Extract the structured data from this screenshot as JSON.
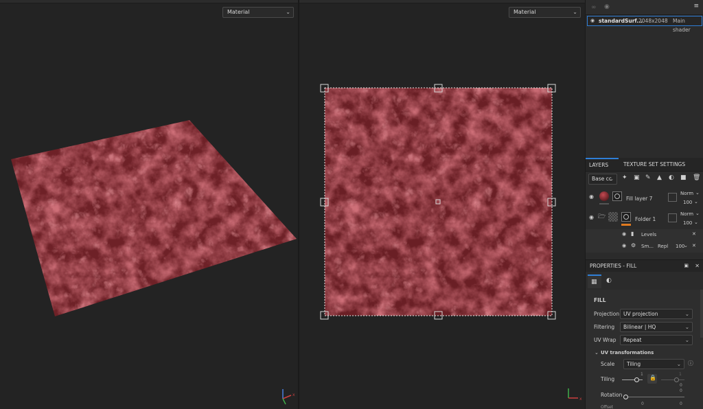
{
  "viewport3d": {
    "dropdown": "Material",
    "axis_x": "x"
  },
  "viewport2d": {
    "dropdown": "Material",
    "axis_x": "x"
  },
  "texture_set": {
    "name": "standardSurf...",
    "resolution": "2048x2048",
    "shader": "Main shader"
  },
  "layers_panel": {
    "tab_layers": "LAYERS",
    "tab_texture_settings": "TEXTURE SET SETTINGS",
    "channel": "Base cc",
    "layers": [
      {
        "name": "Fill layer 7",
        "blend": "Norm",
        "opacity": "100"
      },
      {
        "name": "Folder 1",
        "blend": "Norm",
        "opacity": "100"
      }
    ],
    "effects": [
      {
        "name": "Levels"
      },
      {
        "name": "Sm...",
        "blend": "Repl",
        "opacity": "100"
      }
    ]
  },
  "properties": {
    "header": "PROPERTIES - FILL",
    "section": "FILL",
    "projection_label": "Projection",
    "projection_value": "UV projection",
    "filtering_label": "Filtering",
    "filtering_value": "Bilinear | HQ",
    "uvwrap_label": "UV Wrap",
    "uvwrap_value": "Repeat",
    "uv_transform_label": "UV transformations",
    "scale_label": "Scale",
    "scale_value": "Tiling",
    "tiling_label": "Tiling",
    "tiling_value_a": "1",
    "tiling_value_b": "1",
    "tiling_num": "0",
    "rotation_label": "Rotation",
    "rotation_value": "0",
    "offset_label": "Offset",
    "offset_a": "0",
    "offset_b": "0"
  },
  "colors": {
    "accent": "#2f7fd8",
    "orange": "#e07a1f",
    "material": "#8a2a30"
  }
}
